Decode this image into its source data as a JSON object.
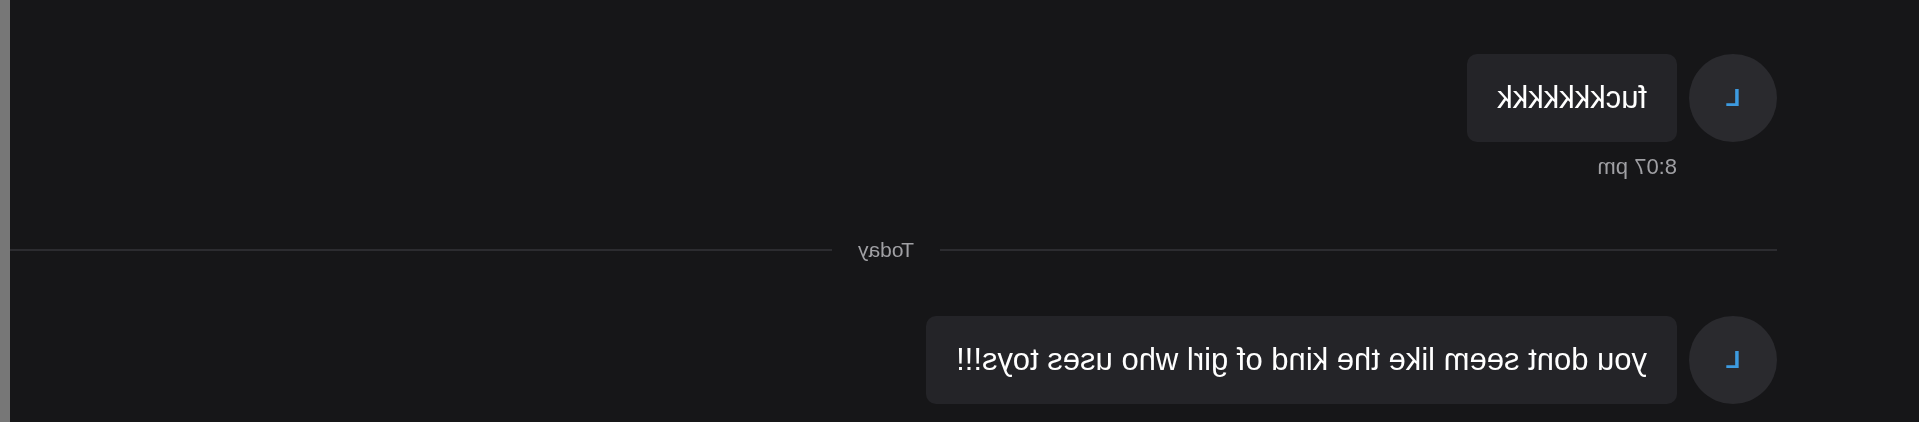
{
  "messages_before": [
    {
      "avatar": "L",
      "text": "fuckkkkkkk",
      "time": "8:07 pm"
    }
  ],
  "divider": {
    "label": "Today"
  },
  "messages_after": [
    {
      "avatar": "L",
      "text": "you dont seem like the kind of girl who uses toys!!!"
    }
  ]
}
